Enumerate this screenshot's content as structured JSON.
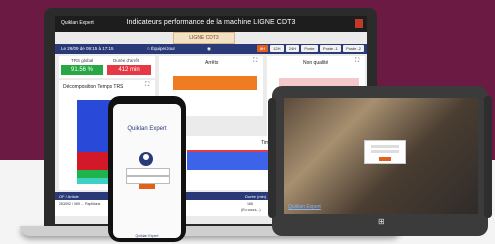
{
  "colors": {
    "brand_primary": "#2a3a78",
    "accent_orange": "#e25f1c",
    "kpi_green": "#28a745",
    "kpi_red": "#e63946",
    "background_band": "#6a1a43"
  },
  "laptop": {
    "app_title": "Indicateurs performance de la machine LIGNE CDT3",
    "logo_text": "Quiklan Expert",
    "line_tab": "LIGNE CDT3",
    "date_text": "Le 29/09 de 09:15 à 17:15",
    "radio_1": "Équipe/Jour",
    "radio_2": "",
    "range_buttons": [
      "8H",
      "12H",
      "24H",
      "Poste",
      "Poste -1",
      "Poste -2"
    ],
    "kpis": [
      {
        "label": "TRS global",
        "value": "91.56 %"
      },
      {
        "label": "Durée d'arrêt",
        "value": "412 min"
      }
    ],
    "cards": {
      "decomposition": "Décomposition Temps TRS",
      "arrets": "Arrêts",
      "non_qualite": "Non qualité",
      "timeline": "Timel"
    },
    "table": {
      "headers": [
        "OF / Article",
        "",
        "",
        "Pièces",
        "Durée (min)",
        "Qté bonne",
        "Cadence"
      ],
      "row": [
        "263092 / 069 ... Papillions",
        "",
        "",
        "",
        "166",
        "2995",
        ""
      ],
      "row_sub": [
        "",
        "",
        "",
        "",
        "(En cours...)",
        "",
        ""
      ]
    }
  },
  "phone": {
    "logo": "Quiklan Expert",
    "footer": "Quiklan Expert"
  },
  "tablet": {
    "link": "Quiklan Expert"
  }
}
